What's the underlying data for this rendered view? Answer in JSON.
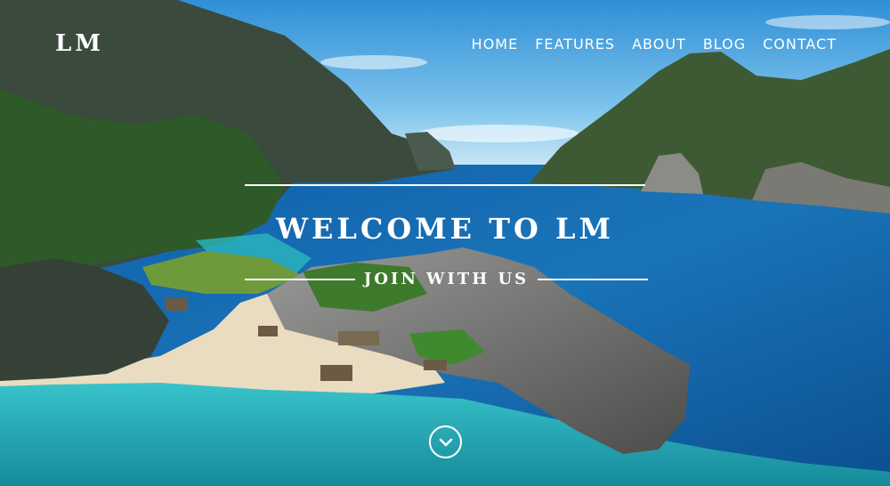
{
  "brand": {
    "logo": "LM"
  },
  "nav": {
    "items": [
      {
        "label": "HOME"
      },
      {
        "label": "FEATURES"
      },
      {
        "label": "ABOUT"
      },
      {
        "label": "BLOG"
      },
      {
        "label": "CONTACT"
      }
    ]
  },
  "hero": {
    "headline": "WELCOME TO LM",
    "subheadline": "JOIN WITH US",
    "scroll_icon": "chevron-down-icon",
    "background": "tropical-lagoon-photo"
  },
  "colors": {
    "text": "#ffffff",
    "sky": "#4aa8df",
    "sea": "#1a74b8",
    "lagoon": "#29c0c8"
  }
}
